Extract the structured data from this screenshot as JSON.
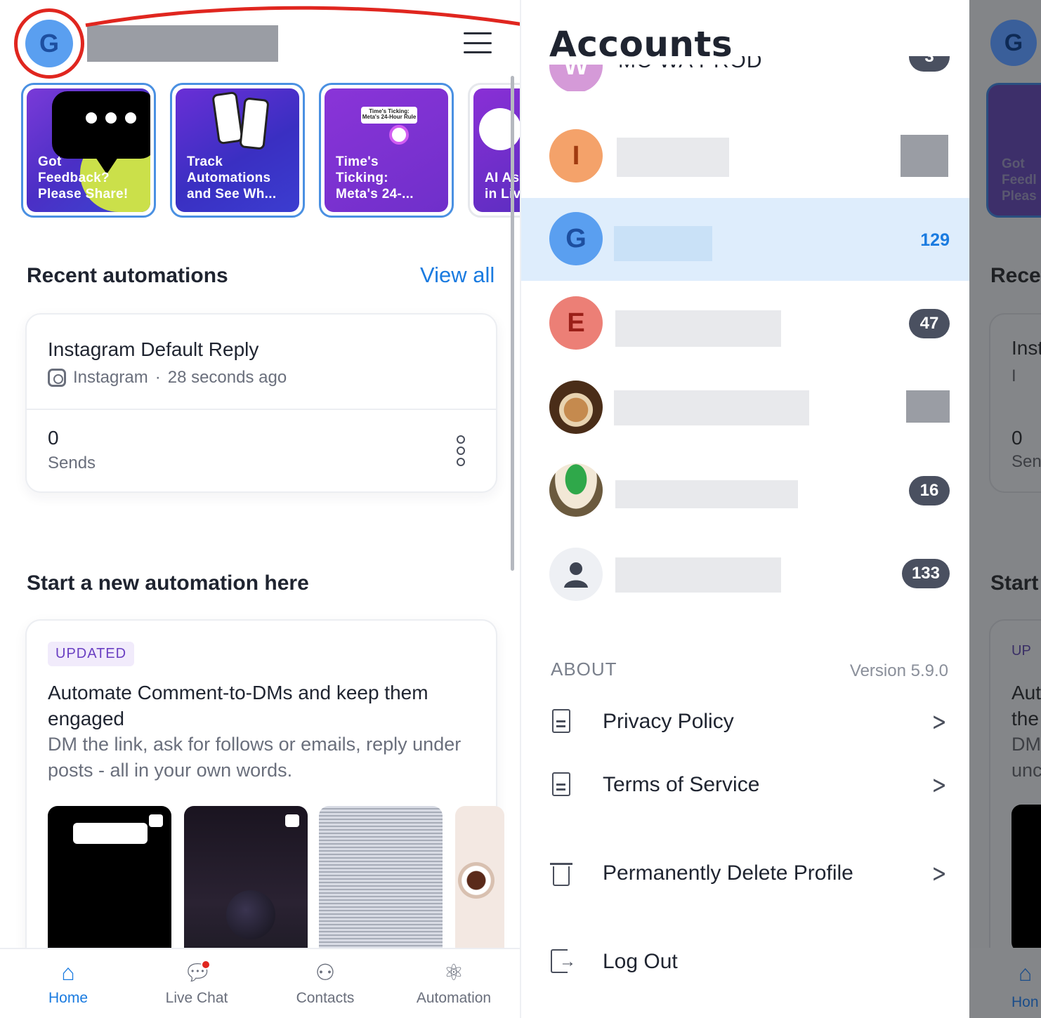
{
  "left": {
    "stories": [
      {
        "caption_l1": "Got",
        "caption_l2": "Feedback?",
        "caption_l3": "Please Share!"
      },
      {
        "caption_l1": "Track",
        "caption_l2": "Automations",
        "caption_l3": "and See Wh..."
      },
      {
        "caption_l1": "Time's",
        "caption_l2": "Ticking:",
        "caption_l3": "Meta's 24-...",
        "art_text": "Time's Ticking: Meta's 24-Hour Rule"
      },
      {
        "caption_l1": "AI As",
        "caption_l2": "in Liv"
      }
    ],
    "recent_title": "Recent automations",
    "view_all": "View all",
    "recent_card": {
      "title": "Instagram Default Reply",
      "channel": "Instagram",
      "separator": "·",
      "time": "28 seconds ago",
      "sends_value": "0",
      "sends_label": "Sends"
    },
    "start_title": "Start a new automation here",
    "template_card": {
      "badge": "UPDATED",
      "title": "Automate Comment-to-DMs and keep them engaged",
      "description": "DM the link, ask for follows or emails, reply under posts - all in your own words."
    },
    "tabs": [
      {
        "label": "Home",
        "icon": "home-icon",
        "active": true
      },
      {
        "label": "Live Chat",
        "icon": "chat-icon",
        "active": false
      },
      {
        "label": "Contacts",
        "icon": "contacts-icon",
        "active": false
      },
      {
        "label": "Automation",
        "icon": "automation-icon",
        "active": false
      }
    ],
    "avatar_letter": "G"
  },
  "accounts": {
    "title": "Accounts",
    "partial_row": {
      "letter": "W",
      "name": "MC WA PROD",
      "count": "3"
    },
    "rows": [
      {
        "letter": "I",
        "avatar_color": "#f4a26a",
        "letter_color": "#a03a10",
        "count": ""
      },
      {
        "letter": "G",
        "avatar_color": "#5a9ff0",
        "letter_color": "#1d4fa0",
        "count": "129",
        "selected": true
      },
      {
        "letter": "E",
        "avatar_color": "#ec7f76",
        "letter_color": "#9a1f18",
        "count": "47"
      },
      {
        "letter": "",
        "avatar_type": "photo-dog",
        "count": ""
      },
      {
        "letter": "",
        "avatar_type": "photo-lamp",
        "count": "16"
      },
      {
        "letter": "",
        "avatar_type": "default-user",
        "count": "133"
      }
    ],
    "about_label": "ABOUT",
    "version": "Version 5.9.0",
    "menu": [
      {
        "label": "Privacy Policy",
        "icon": "document-icon"
      },
      {
        "label": "Terms of Service",
        "icon": "document-icon"
      },
      {
        "label": "Permanently Delete Profile",
        "icon": "trash-icon"
      },
      {
        "label": "Log Out",
        "icon": "logout-icon"
      }
    ]
  },
  "sliver": {
    "avatar_letter": "G",
    "story_l1": "Got",
    "story_l2": "Feedl",
    "story_l3": "Pleas",
    "recent": "Rece",
    "card_title": "Inst",
    "card_sub": "I",
    "sends_value": "0",
    "sends_label": "Sen",
    "start": "Start",
    "badge": "UP",
    "desc_l1": "Aut",
    "desc_l2": "the",
    "desc_l3": "DM",
    "desc_l4": "unc",
    "tab": "Hon"
  },
  "colors": {
    "accent_blue": "#1a7be0",
    "selected_row": "#deedfc",
    "annotation_red": "#e0261f",
    "count_pill": "#4a5060"
  }
}
